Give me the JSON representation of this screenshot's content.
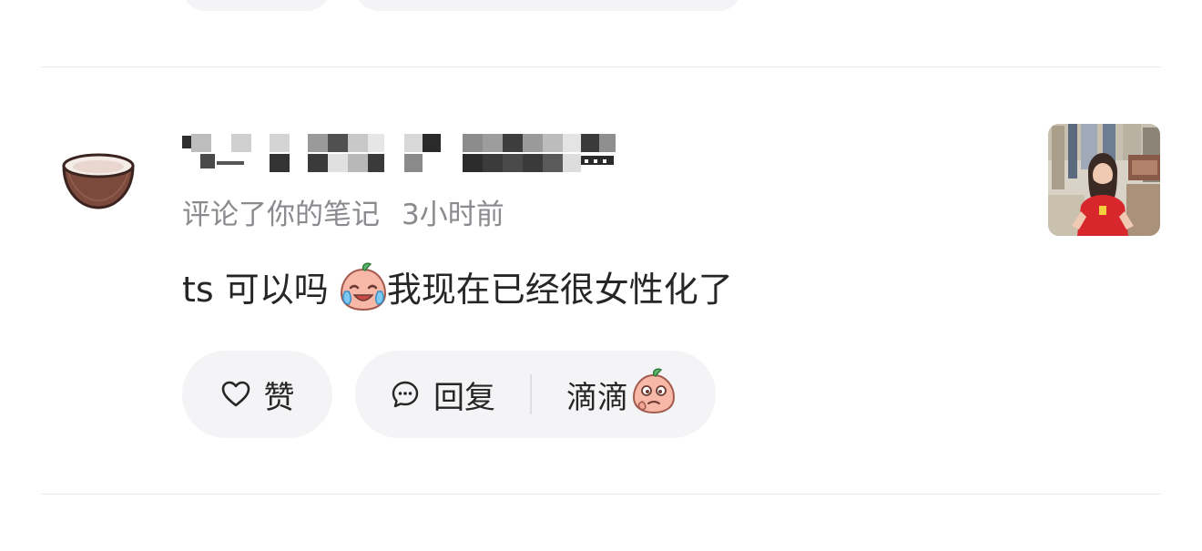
{
  "notification": {
    "action_text": "评论了你的笔记",
    "time": "3小时前",
    "comment": {
      "text_before_sticker": "ts 可以吗 ",
      "sticker_icon": "crying-laughing-peach-sticker-icon",
      "text_after_sticker": "我现在已经很女性化了"
    },
    "actions": {
      "like_label": "赞",
      "reply_label": "回复",
      "quick_reply_label": "滴滴",
      "quick_reply_sticker_icon": "peach-thinking-sticker-icon"
    },
    "avatar_icon": "coconut-bowl-icon",
    "thumbnail_icon": "note-cover-thumbnail"
  },
  "colors": {
    "text": "#262626",
    "secondary_text": "#8a8a8f",
    "pill_bg": "#f4f4f6",
    "divider": "#e9e9ec"
  }
}
